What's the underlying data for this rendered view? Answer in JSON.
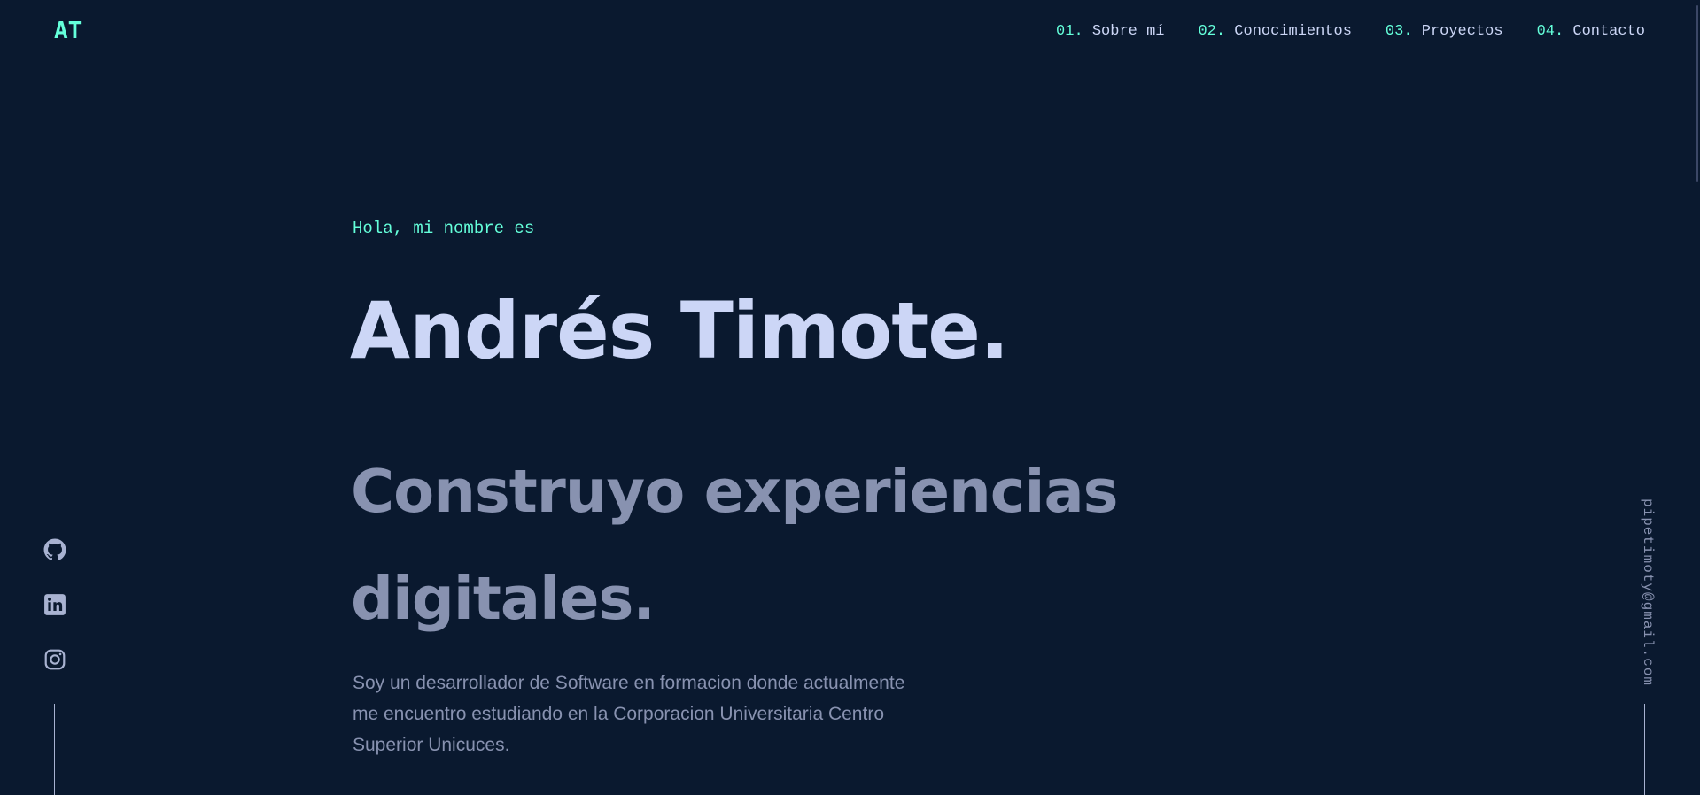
{
  "header": {
    "logo": "AT",
    "nav": [
      {
        "num": "01.",
        "label": "Sobre mí"
      },
      {
        "num": "02.",
        "label": "Conocimientos"
      },
      {
        "num": "03.",
        "label": "Proyectos"
      },
      {
        "num": "04.",
        "label": "Contacto"
      }
    ]
  },
  "hero": {
    "greeting": "Hola, mi nombre es",
    "name": "Andrés Timote.",
    "tagline": [
      "Construyo experiencias",
      "digitales."
    ],
    "bio": [
      "Soy un desarrollador de Software en formacion donde actualmente",
      "me encuentro estudiando en la Corporacion Universitaria Centro",
      "Superior Unicuces."
    ]
  },
  "social": {
    "icons": [
      "github-icon",
      "linkedin-icon",
      "instagram-icon"
    ]
  },
  "email": {
    "address": "pipetimoty@gmail.com"
  },
  "colors": {
    "background": "#0a192f",
    "accent": "#64ffda",
    "heading": "#ccd6f6",
    "muted": "#8892b0"
  }
}
